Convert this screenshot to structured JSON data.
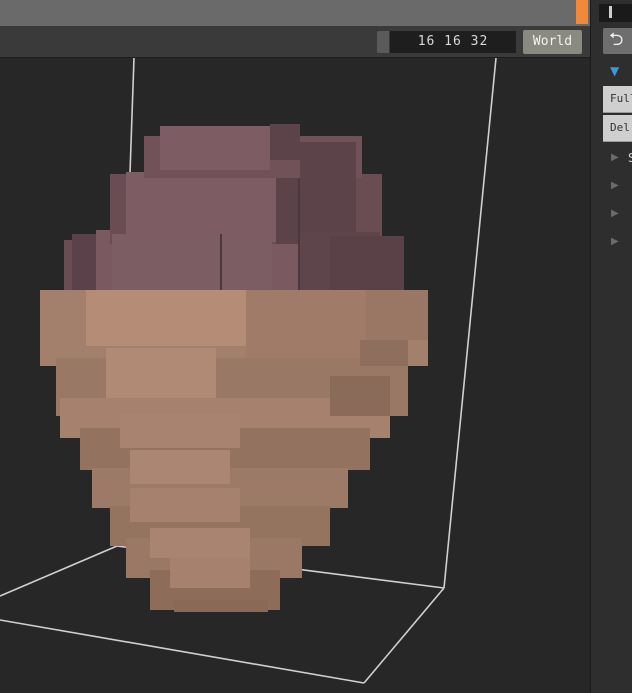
{
  "toolbar": {
    "dimensions": "16 16 32",
    "space_button": "World"
  },
  "sidebar": {
    "undo_icon": "undo-icon",
    "buttons": [
      "Full",
      "Del"
    ],
    "tree_rows": [
      "S",
      "",
      "",
      ""
    ]
  },
  "colors": {
    "accent": "#f0893a",
    "expand_arrow": "#3e97d6",
    "cap_top": "#7a5a60",
    "cap_shadow": "#5c434a",
    "skin_top": "#b28a74",
    "skin_shadow": "#8e6c5c",
    "bounding_box": "#d8d8d8"
  }
}
